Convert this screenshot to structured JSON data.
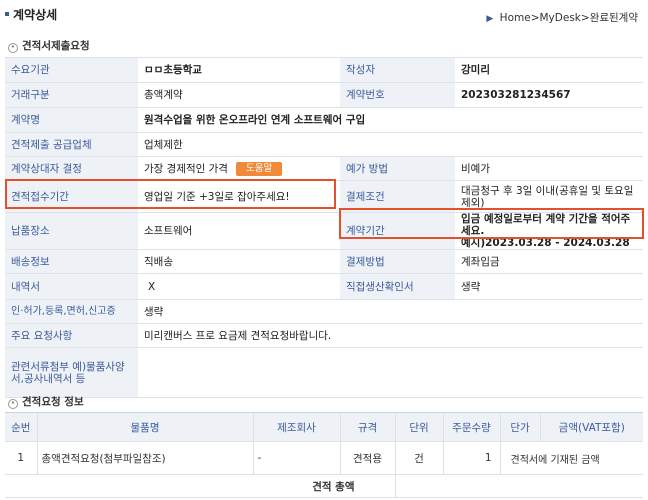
{
  "page": {
    "title": "계약상세",
    "breadcrumb": [
      "Home",
      "MyDesk",
      "완료된계약"
    ],
    "breadcrumb_sep": ">"
  },
  "section1": {
    "title": "견적서제출요청"
  },
  "details": {
    "demand_org_label": "수요기관",
    "demand_org_value": "ㅁㅁ초등학교",
    "author_label": "작성자",
    "author_value": "강미리",
    "trade_type_label": "거래구분",
    "trade_type_value": "총액계약",
    "contract_no_label": "계약번호",
    "contract_no_value": "202303281234567",
    "contract_name_label": "계약명",
    "contract_name_value": "원격수업을 위한 온오프라인 연계 소프트웨어 구입",
    "supplier_label": "견적제출 공급업체",
    "supplier_value": "업체제한",
    "decision_label": "계약상대자 결정",
    "decision_value": "가장 경제적인 가격",
    "help_button": "도움말",
    "price_method_label": "예가 방법",
    "price_method_value": "비예가",
    "quote_period_label": "견적접수기간",
    "quote_period_value": "영업일 기준 +3일로 잡아주세요!",
    "payment_terms_label": "결제조건",
    "payment_terms_value": "대금청구 후 3일 이내(공휴일 및 토요일 제외)",
    "delivery_place_label": "납품장소",
    "delivery_place_value": "소프트웨어",
    "contract_period_label": "계약기간",
    "contract_period_line1": "입금 예정일로부터 계약 기간을 적어주세요.",
    "contract_period_line2": "예시)2023.03.28 - 2024.03.28",
    "shipping_label": "배송정보",
    "shipping_value": "직배송",
    "payment_method_label": "결제방법",
    "payment_method_value": "계좌입금",
    "invoice_label": "내역서",
    "invoice_value": "X",
    "direct_prod_label": "직접생산확인서",
    "direct_prod_value": "생략",
    "license_label": "인·허가,등록,면허,신고증",
    "license_value": "생략",
    "request_label": "주요 요청사항",
    "request_value": "미리캔버스 프로 요금제 견적요청바랍니다.",
    "docs_label": "관련서류첨부 예)물품사양서,공사내역서 등",
    "docs_value": ""
  },
  "section2": {
    "title": "견적요청 정보"
  },
  "items": {
    "headers": [
      "순번",
      "물품명",
      "제조회사",
      "규격",
      "단위",
      "주문수량",
      "단가",
      "금액(VAT포함)"
    ],
    "row": {
      "no": "1",
      "name": "총액견적요청(첨부파일참조)",
      "maker": "-",
      "spec": "견적용",
      "unit": "건",
      "qty": "1",
      "price_note": "견적서에 기재된 금액"
    },
    "total_label": "견적 총액"
  }
}
